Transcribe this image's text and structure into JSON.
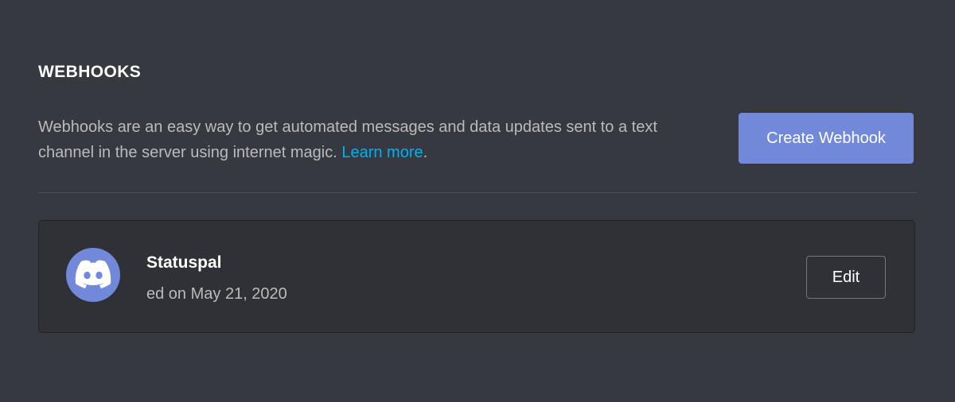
{
  "header": {
    "title": "WEBHOOKS"
  },
  "intro": {
    "description": "Webhooks are an easy way to get automated messages and data updates sent to a text channel in the server using internet magic.",
    "learn_more_label": "Learn more",
    "trailing_punct": "."
  },
  "actions": {
    "create_label": "Create Webhook"
  },
  "webhooks": [
    {
      "name": "Statuspal",
      "meta": "ed on May 21, 2020",
      "avatar_icon": "discord-logo-icon",
      "edit_label": "Edit"
    }
  ],
  "colors": {
    "background": "#36393f",
    "card": "#2f3136",
    "brand": "#7289da",
    "link": "#00b0f4",
    "muted_text": "#b9bbbe"
  }
}
